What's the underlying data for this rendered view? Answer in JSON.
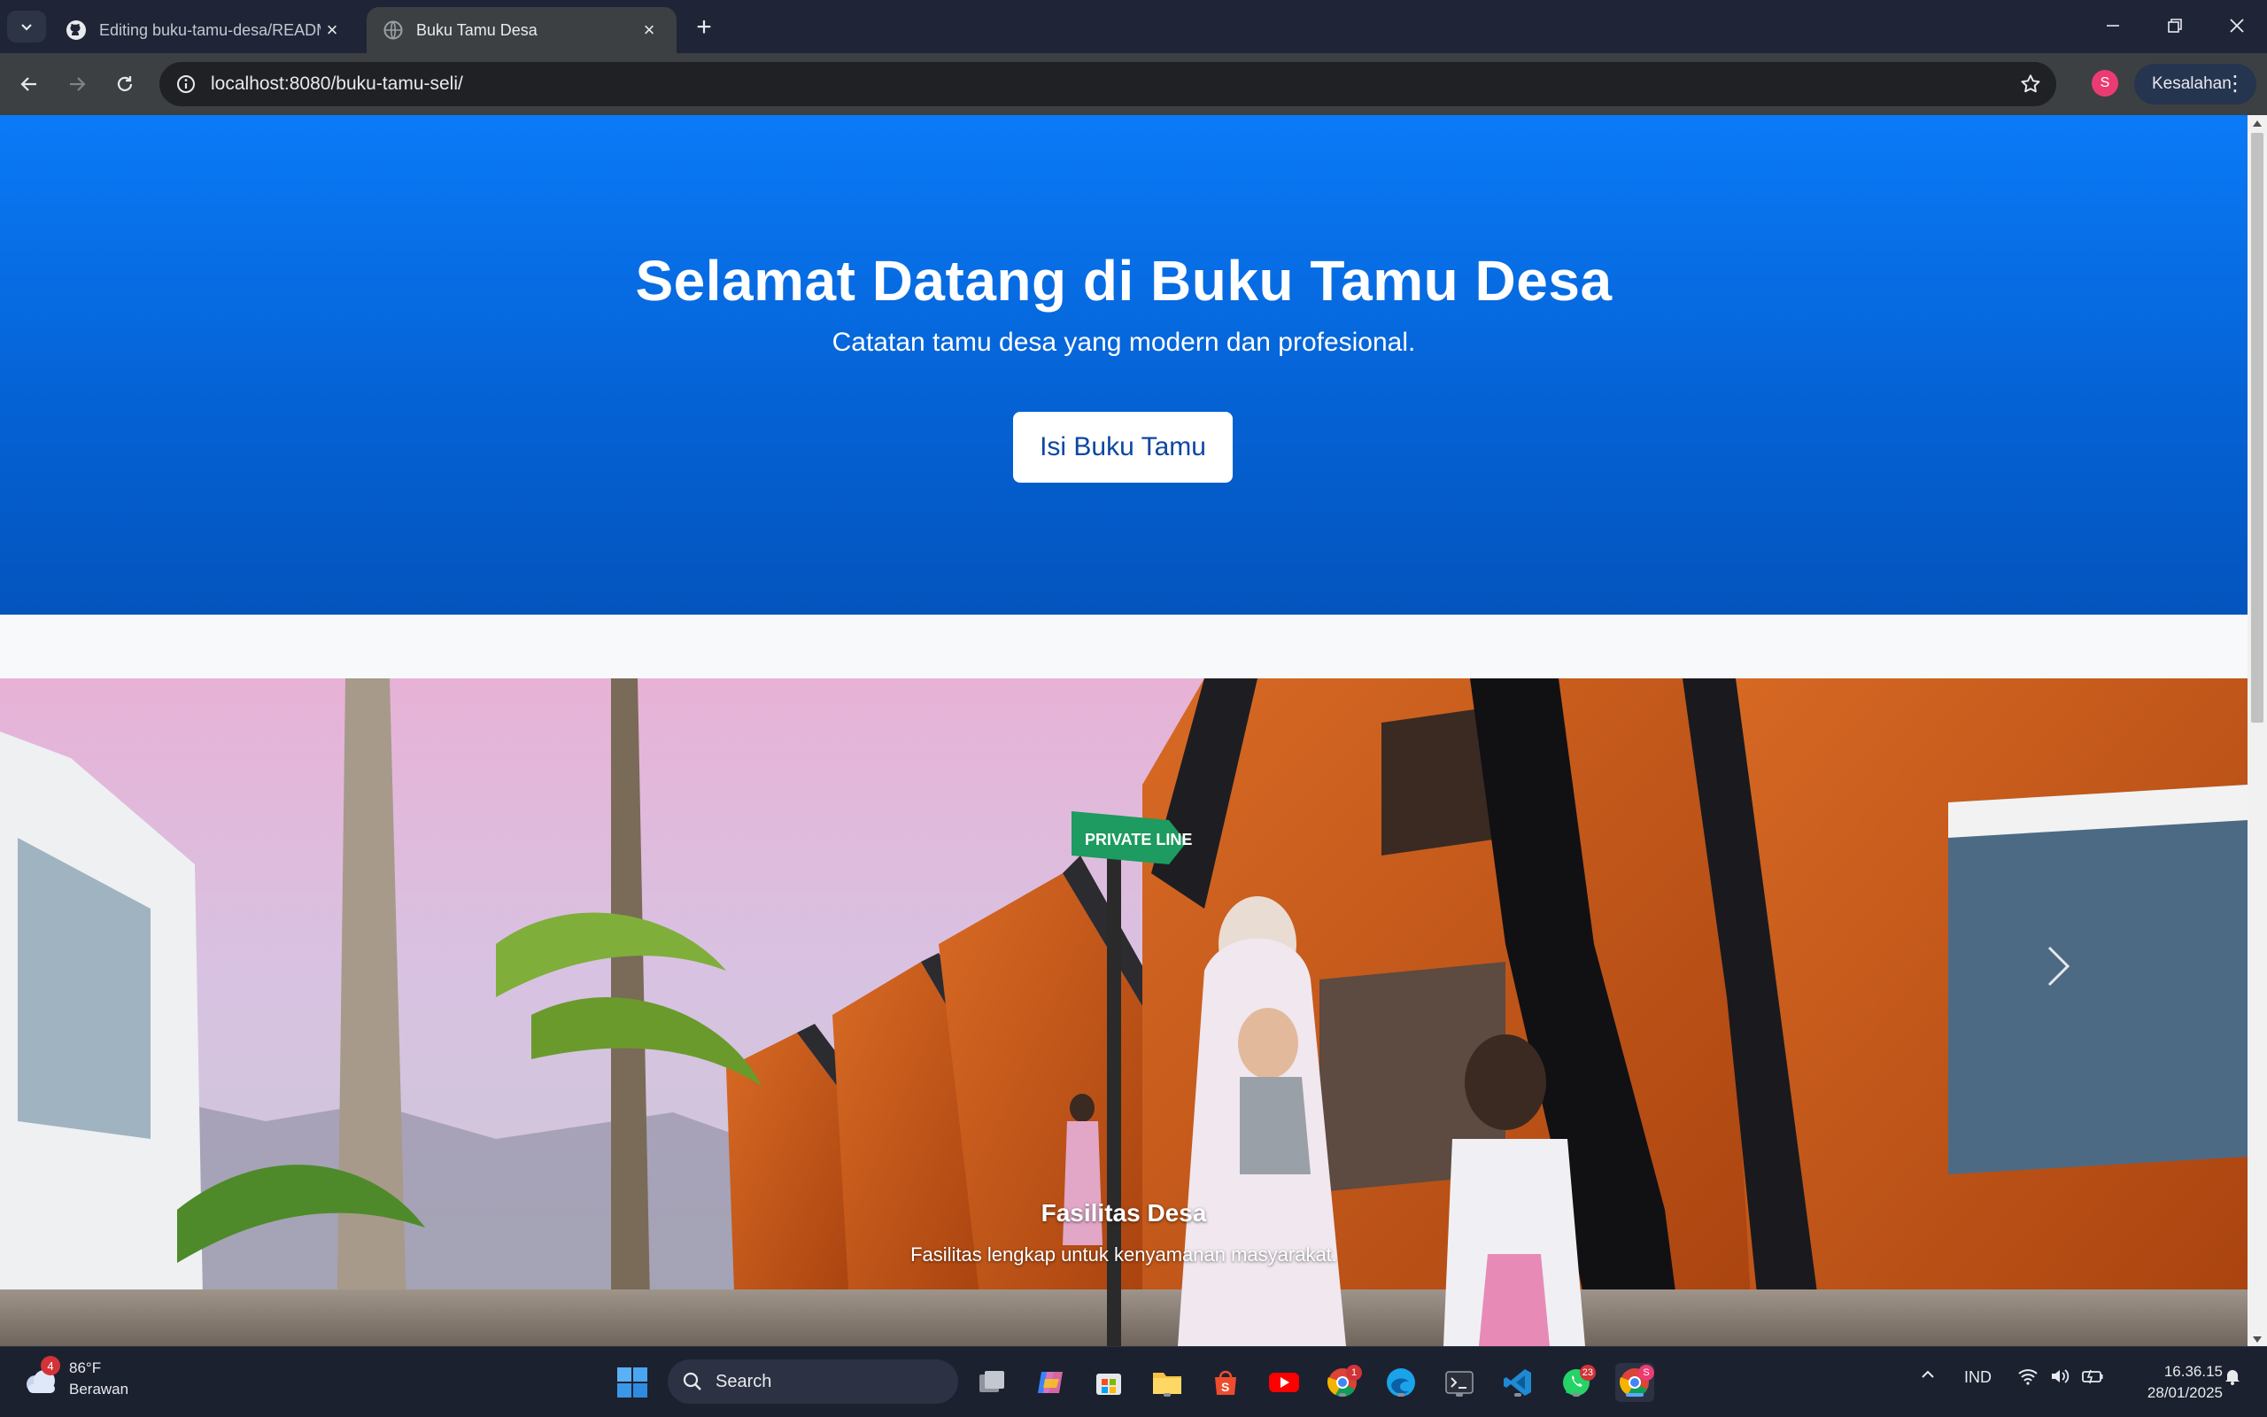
{
  "browser": {
    "tabs": [
      {
        "title": "Editing buku-tamu-desa/READM",
        "active": false,
        "icon": "github-icon"
      },
      {
        "title": "Buku Tamu Desa",
        "active": true,
        "icon": "globe-icon"
      }
    ],
    "url_host": "localhost",
    "url_rest": ":8080/buku-tamu-seli/",
    "profile_initial": "S",
    "profile_label": "Kesalahan"
  },
  "page": {
    "hero": {
      "title": "Selamat Datang di Buku Tamu Desa",
      "subtitle": "Catatan tamu desa yang modern dan profesional.",
      "cta_label": "Isi Buku Tamu"
    },
    "carousel": {
      "caption_title": "Fasilitas Desa",
      "caption_text": "Fasilitas lengkap untuk kenyamanan masyarakat.",
      "sign_text": "PRIVATE LINE"
    }
  },
  "taskbar": {
    "weather_badge": "4",
    "weather_temp": "86°F",
    "weather_desc": "Berawan",
    "search_label": "Search",
    "chrome_badge": "1",
    "whatsapp_badge": "23",
    "chrome_profile_badge": "S",
    "language": "IND",
    "time": "16.36.15",
    "date": "28/01/2025"
  },
  "colors": {
    "hero_top": "#0a7af7",
    "hero_bottom": "#0454bd",
    "button_text": "#0d47a1"
  }
}
